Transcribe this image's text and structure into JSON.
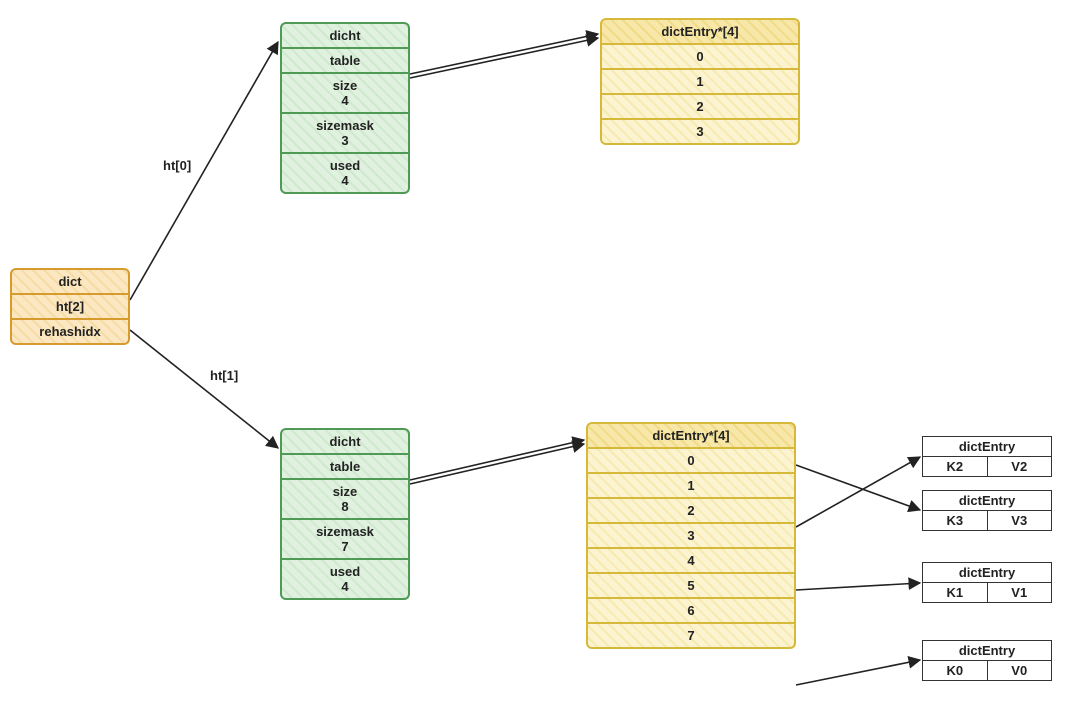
{
  "dict": {
    "title": "dict",
    "ht_label": "ht[2]",
    "rehashidx": "rehashidx"
  },
  "edges": {
    "ht0": "ht[0]",
    "ht1": "ht[1]"
  },
  "ht0": {
    "title": "dicht",
    "table": "table",
    "size_label": "size",
    "size_value": "4",
    "sizemask_label": "sizemask",
    "sizemask_value": "3",
    "used_label": "used",
    "used_value": "4"
  },
  "ht1": {
    "title": "dicht",
    "table": "table",
    "size_label": "size",
    "size_value": "8",
    "sizemask_label": "sizemask",
    "sizemask_value": "7",
    "used_label": "used",
    "used_value": "4"
  },
  "arr0": {
    "header": "dictEntry*[4]",
    "slots": [
      "0",
      "1",
      "2",
      "3"
    ]
  },
  "arr1": {
    "header": "dictEntry*[4]",
    "slots": [
      "0",
      "1",
      "2",
      "3",
      "4",
      "5",
      "6",
      "7"
    ]
  },
  "entries": {
    "e0": {
      "title": "dictEntry",
      "k": "K2",
      "v": "V2"
    },
    "e1": {
      "title": "dictEntry",
      "k": "K3",
      "v": "V3"
    },
    "e2": {
      "title": "dictEntry",
      "k": "K1",
      "v": "V1"
    },
    "e3": {
      "title": "dictEntry",
      "k": "K0",
      "v": "V0"
    }
  }
}
